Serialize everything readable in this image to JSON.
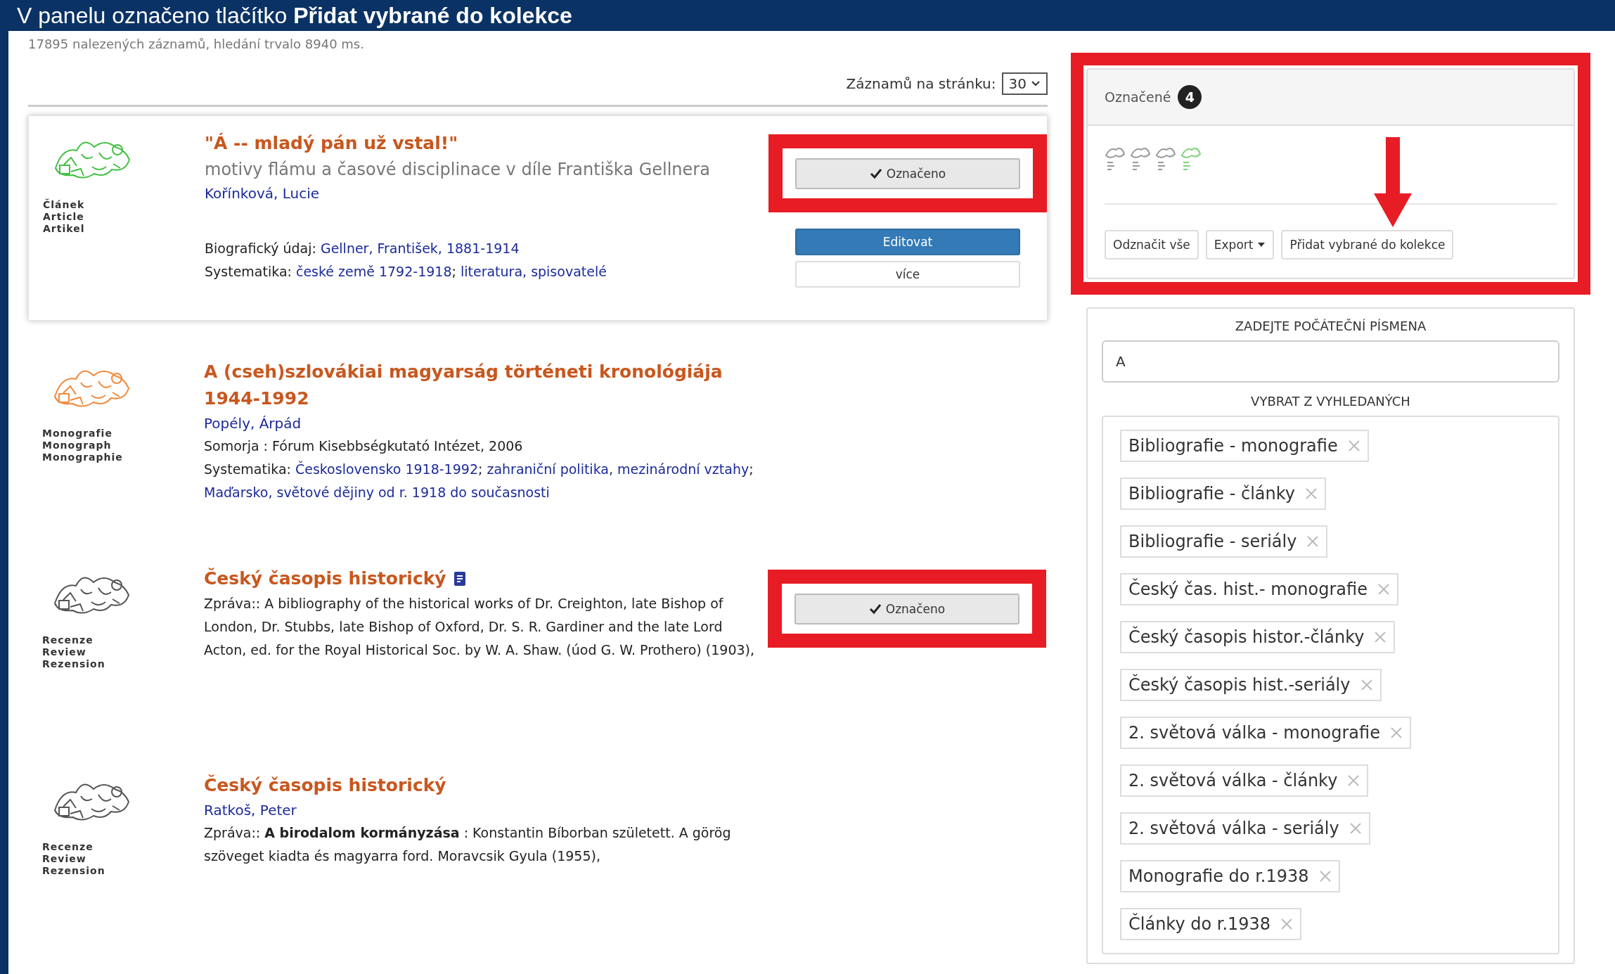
{
  "banner": {
    "text": "V panelu označeno tlačítko **Přidat vybrané do kolekce**"
  },
  "results_summary": "17895 nalezených záznamů, hledání trvalo 8940 ms.",
  "page_size": {
    "label": "Záznamů na stránku:",
    "value": "30"
  },
  "records": [
    {
      "selected": true,
      "color": "#44c044",
      "type_labels": [
        "Článek",
        "Article",
        "Artikel"
      ],
      "title": "\"Á -- mladý pán už vstal!\"",
      "subtitle": "motivy flámu a časové disciplinace v díle Františka Gellnera",
      "author": "Kořínková, Lucie",
      "lines": [
        {
          "label": "Biografický údaj:",
          "links": [
            "Gellner, František, 1881-1914"
          ]
        },
        {
          "label": "Systematika:",
          "links": [
            "české země 1792-1918",
            "literatura, spisovatelé"
          ],
          "separator": "; "
        }
      ],
      "actions": [
        {
          "kind": "mark",
          "label": "Označeno",
          "marked": true,
          "highlighted": true
        },
        {
          "kind": "primary",
          "label": "Editovat"
        },
        {
          "kind": "default",
          "label": "více"
        }
      ]
    },
    {
      "color": "#f08a3c",
      "type_labels": [
        "Monografie",
        "Monograph",
        "Monographie"
      ],
      "title": "A (cseh)szlovákiai magyarság történeti kronológiája 1944-1992",
      "author": "Popély, Árpád",
      "lines": [
        {
          "value": "Somorja : Fórum Kisebbségkutató Intézet, 2006"
        },
        {
          "label": "Systematika:",
          "links": [
            "Československo 1918-1992",
            "zahraniční politika, mezinárodní vztahy",
            "Maďarsko, světové dějiny od r. 1918 do současnosti"
          ],
          "separator": "; "
        }
      ]
    },
    {
      "color": "#555555",
      "type_labels": [
        "Recenze",
        "Review",
        "Rezension"
      ],
      "title": "Český časopis historický",
      "title_icon": true,
      "lines": [
        {
          "label": "Zpráva::",
          "value": "A bibliography of the historical works of Dr. Creighton, late Bishop of London, Dr. Stubbs, late Bishop of Oxford, Dr. S. R. Gardiner and the late Lord Acton, ed. for the Royal Historical Soc. by W. A. Shaw. (úod G. W. Prothero) (1903),"
        }
      ],
      "actions": [
        {
          "kind": "mark",
          "label": "Označeno",
          "marked": true,
          "highlighted": true
        }
      ]
    },
    {
      "color": "#555555",
      "type_labels": [
        "Recenze",
        "Review",
        "Rezension"
      ],
      "title": "Český časopis historický",
      "author": "Ratkoš, Peter",
      "lines": [
        {
          "label": "Zpráva::",
          "value": "**A birodalom kormányzása** : Konstantin Bíborban született. A görög szöveget kiadta és magyarra ford. Moravcsik Gyula (1955),"
        }
      ]
    }
  ],
  "marked_panel": {
    "highlighted": true,
    "title": "Označené",
    "count": "4",
    "thumbnails": [
      {
        "color": "#9a9a9a"
      },
      {
        "color": "#9a9a9a"
      },
      {
        "color": "#9a9a9a"
      },
      {
        "color": "#7fd07f"
      }
    ],
    "buttons": [
      {
        "kind": "plain",
        "label": "Odznačit vše"
      },
      {
        "kind": "dropdown",
        "label": "Export"
      },
      {
        "kind": "plain",
        "label": "Přidat vybrané do kolekce",
        "pointed": true
      }
    ]
  },
  "collections_panel": {
    "heading": "ZADEJTE POČÁTEČNÍ PÍSMENA",
    "input_value": "A",
    "subheading": "VYBRAT Z VYHLEDANÝCH",
    "tags": [
      "Bibliografie - monografie",
      "Bibliografie - články",
      "Bibliografie - seriály",
      "Český čas. hist.- monografie",
      "Český časopis histor.-články",
      "Český časopis hist.-seriály",
      "2. světová válka - monografie",
      "2. světová válka - články",
      "2. světová válka - seriály",
      "Monografie do r.1938",
      "Články do r.1938"
    ]
  }
}
